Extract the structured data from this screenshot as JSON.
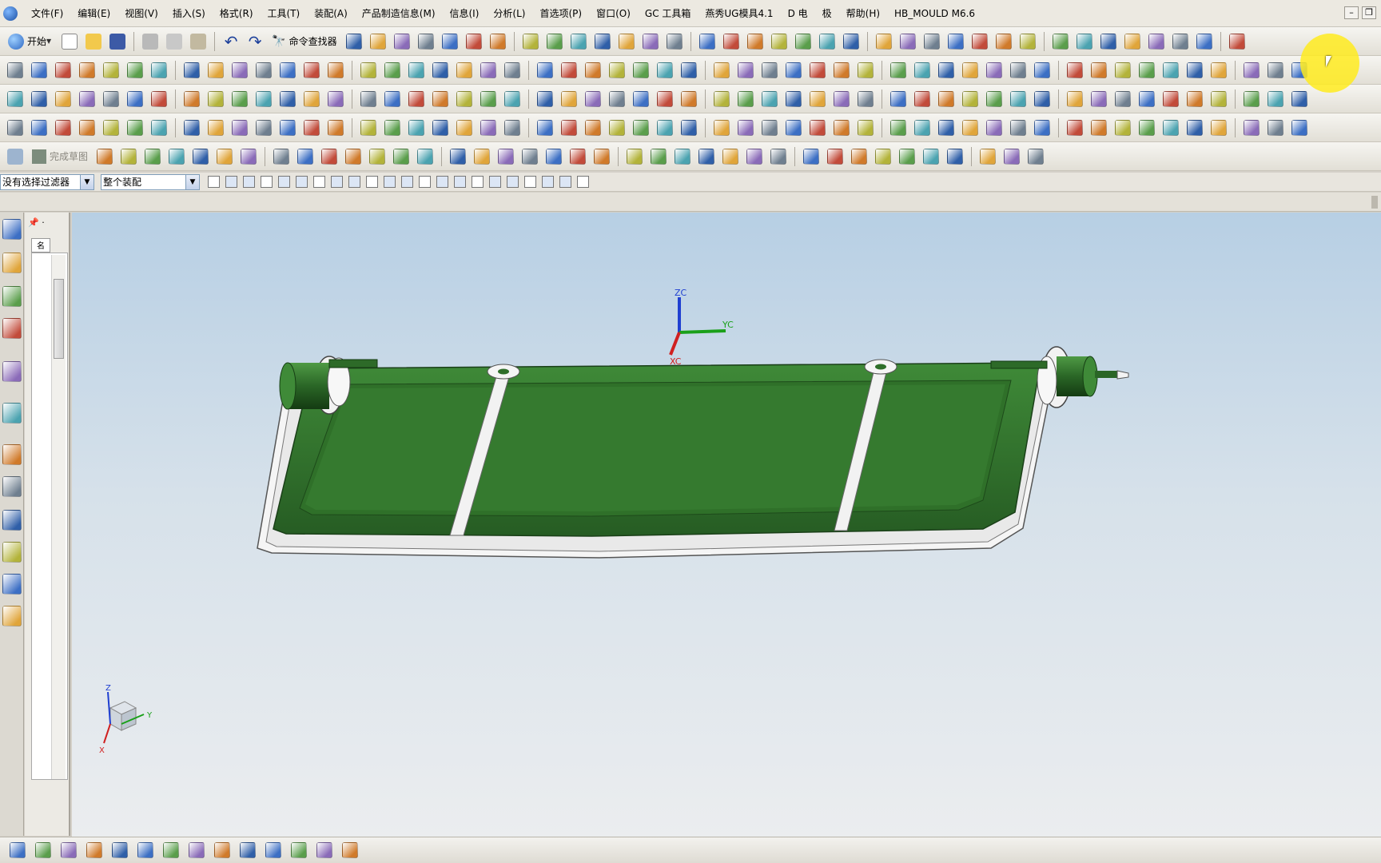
{
  "menu": {
    "items": [
      "文件(F)",
      "编辑(E)",
      "视图(V)",
      "插入(S)",
      "格式(R)",
      "工具(T)",
      "装配(A)",
      "产品制造信息(M)",
      "信息(I)",
      "分析(L)",
      "首选项(P)",
      "窗口(O)",
      "GC 工具箱",
      "燕秀UG模具4.1",
      "D 电",
      "极",
      "帮助(H)",
      "HB_MOULD M6.6"
    ]
  },
  "toolbar1": {
    "start_label": "开始",
    "command_finder_label": "命令查找器"
  },
  "toolbar5": {
    "finish_sketch_label": "完成草图"
  },
  "selection_bar": {
    "filter_value": "没有选择过滤器",
    "scope_value": "整个装配"
  },
  "navigator": {
    "tab_label": "名"
  },
  "viewport": {
    "wcs_labels": {
      "z": "ZC",
      "y": "YC",
      "x": "XC"
    },
    "triad_labels": {
      "z": "Z",
      "y": "Y",
      "x": "X"
    }
  },
  "colors": {
    "part_green": "#2e6b2a",
    "part_rim": "#f2f2f2",
    "highlight": "#ffe81e",
    "wcs_z": "#1f3fd1",
    "wcs_y": "#1aa01a",
    "wcs_x": "#d02020"
  }
}
